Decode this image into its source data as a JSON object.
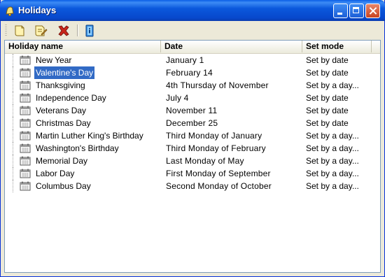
{
  "window": {
    "title": "Holidays"
  },
  "toolbar": {
    "new": {
      "icon": "new-document-icon"
    },
    "edit": {
      "icon": "edit-document-icon"
    },
    "delete": {
      "icon": "delete-x-icon"
    },
    "info": {
      "icon": "info-book-icon"
    }
  },
  "columns": {
    "name": "Holiday name",
    "date": "Date",
    "mode": "Set mode"
  },
  "rows": [
    {
      "name": "New Year",
      "date": "January  1",
      "mode": "Set by date"
    },
    {
      "name": "Valentine's Day",
      "date": "February  14",
      "mode": "Set by date"
    },
    {
      "name": "Thanksgiving",
      "date": "4th Thursday of  November",
      "mode": "Set by a day..."
    },
    {
      "name": "Independence Day",
      "date": "July  4",
      "mode": "Set by date"
    },
    {
      "name": "Veterans Day",
      "date": "November  11",
      "mode": "Set by date"
    },
    {
      "name": "Christmas Day",
      "date": "December  25",
      "mode": "Set by date"
    },
    {
      "name": "Martin Luther King's Birthday",
      "date": "Third Monday of  January",
      "mode": "Set by a day..."
    },
    {
      "name": "Washington's Birthday",
      "date": "Third Monday of  February",
      "mode": "Set by a day..."
    },
    {
      "name": "Memorial Day",
      "date": "Last Monday of  May",
      "mode": "Set by a day..."
    },
    {
      "name": "Labor Day",
      "date": "First Monday of  September",
      "mode": "Set by a day..."
    },
    {
      "name": "Columbus Day",
      "date": "Second Monday of  October",
      "mode": "Set by a day..."
    }
  ],
  "selected_row": "Valentine's Day"
}
